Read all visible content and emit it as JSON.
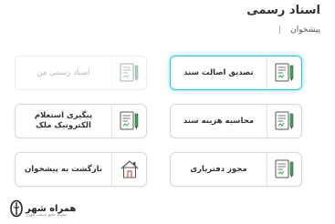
{
  "page": {
    "title": "اسناد رسمی",
    "breadcrumb": {
      "item": "پیشخوان",
      "separator": "|"
    }
  },
  "cards": [
    {
      "label": "تصدیق اصالت سند",
      "icon": "document-pen-icon",
      "state": "selected"
    },
    {
      "label": "اسناد رسمی من",
      "icon": "document-pen-icon",
      "state": "disabled"
    },
    {
      "label": "محاسبه هزینه سند",
      "icon": "document-pen-icon",
      "state": "normal"
    },
    {
      "label": "پیگیری استعلام الکترونیک ملک",
      "icon": "document-pen-icon",
      "state": "normal"
    },
    {
      "label": "مجوز دفترياری",
      "icon": "document-pen-icon",
      "state": "normal"
    },
    {
      "label": "بازگشت به پیشخوان",
      "icon": "home-icon",
      "state": "normal"
    }
  ],
  "watermark": {
    "title": "همراه شهر",
    "subtitle": "سامانه جامع خدمات شهری"
  },
  "colors": {
    "accent_border": "#32c1d6",
    "icon_green": "#2fa84f",
    "icon_dark": "#555555"
  }
}
